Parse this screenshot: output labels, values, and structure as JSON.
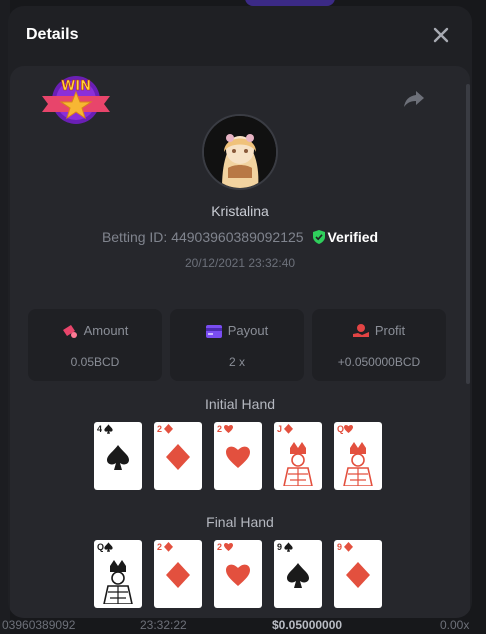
{
  "modal": {
    "title": "Details",
    "close_icon": "close-icon",
    "share_icon": "share-icon",
    "badge_label": "WIN"
  },
  "user": {
    "name": "Kristalina",
    "betting_id_label": "Betting ID:",
    "betting_id": "44903960389092125",
    "verified": "Verified",
    "timestamp": "20/12/2021 23:32:40"
  },
  "stats": {
    "amount": {
      "label": "Amount",
      "value": "0.05BCD"
    },
    "payout": {
      "label": "Payout",
      "value": "2 x"
    },
    "profit": {
      "label": "Profit",
      "value": "+0.050000BCD"
    }
  },
  "initial_hand": {
    "title": "Initial Hand",
    "cards": [
      {
        "rank": "4",
        "suit": "spade",
        "color": "black"
      },
      {
        "rank": "2",
        "suit": "diamond",
        "color": "red"
      },
      {
        "rank": "2",
        "suit": "heart",
        "color": "red"
      },
      {
        "rank": "J",
        "suit": "diamond",
        "color": "red"
      },
      {
        "rank": "Q",
        "suit": "heart",
        "color": "red"
      }
    ]
  },
  "final_hand": {
    "title": "Final Hand",
    "cards": [
      {
        "rank": "Q",
        "suit": "spade",
        "color": "black"
      },
      {
        "rank": "2",
        "suit": "diamond",
        "color": "red"
      },
      {
        "rank": "2",
        "suit": "heart",
        "color": "red"
      },
      {
        "rank": "9",
        "suit": "spade",
        "color": "black"
      },
      {
        "rank": "9",
        "suit": "diamond",
        "color": "red"
      }
    ]
  },
  "background": {
    "footer_id": "03960389092",
    "footer_time": "23:32:22",
    "footer_amount": "$0.05000000",
    "footer_payout": "0.00x"
  },
  "colors": {
    "verified_green": "#2fcf5c",
    "amount_icon": "#e8456b",
    "payout_icon": "#7a4df2",
    "profit_icon": "#e24444"
  }
}
